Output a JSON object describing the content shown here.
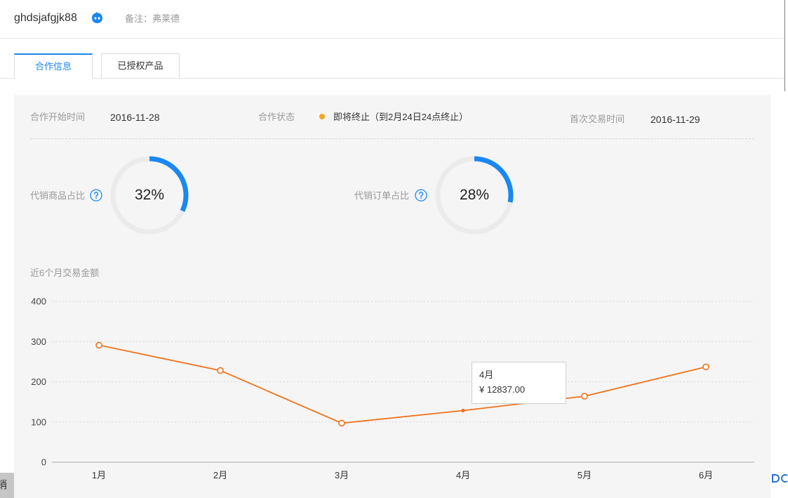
{
  "header": {
    "username": "ghdsjafgjk88",
    "chat_icon": "chat-icon",
    "remark_label": "备注：",
    "remark_value": "弗莱德"
  },
  "tabs": [
    {
      "label": "合作信息",
      "active": true
    },
    {
      "label": "已授权产品",
      "active": false
    }
  ],
  "info": {
    "start_label": "合作开始时间",
    "start_value": "2016-11-28",
    "status_label": "合作状态",
    "status_value": "即将终止（到2月24日24点终止）",
    "status_color": "#f5a623",
    "first_trade_label": "首次交易时间",
    "first_trade_value": "2016-11-29"
  },
  "ratios": [
    {
      "label": "代销商品占比",
      "help_icon": "help-icon",
      "percent": 32,
      "percent_label": "32%"
    },
    {
      "label": "代销订单占比",
      "help_icon": "help-icon",
      "percent": 28,
      "percent_label": "28%"
    }
  ],
  "colors": {
    "accent": "#1a88f0",
    "track": "#ebebeb",
    "line": "#f0721a"
  },
  "chart_data": {
    "type": "line",
    "title": "近6个月交易金额",
    "categories": [
      "1月",
      "2月",
      "3月",
      "4月",
      "5月",
      "6月"
    ],
    "series": [
      {
        "values": [
          291,
          228,
          97,
          128.37,
          164,
          237
        ]
      }
    ],
    "ylim": [
      0,
      400
    ],
    "yticks": [
      0,
      100,
      200,
      300,
      400
    ],
    "grid": true,
    "tooltip": {
      "category": "4月",
      "value_label": "¥ 12837.00"
    }
  },
  "background_fragment": {
    "text": "销"
  }
}
